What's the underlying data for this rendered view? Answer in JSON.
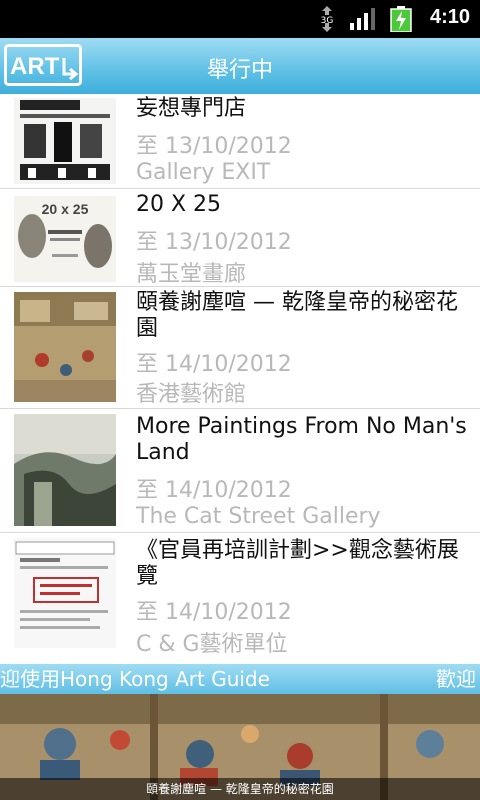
{
  "statusbar": {
    "time": "4:10",
    "network": "3G"
  },
  "header": {
    "logo_text": "ART",
    "title": "舉行中"
  },
  "exhibitions": [
    {
      "title": "妄想專門店",
      "date": "至 13/10/2012",
      "venue": "Gallery EXIT"
    },
    {
      "title": "20 X 25",
      "date": "至 13/10/2012",
      "venue": "萬玉堂畫廊"
    },
    {
      "title": "頤養謝塵喧 — 乾隆皇帝的秘密花園",
      "date": "至 14/10/2012",
      "venue": "香港藝術館"
    },
    {
      "title": "More Paintings From No Man's Land",
      "date": "至 14/10/2012",
      "venue": "The Cat Street Gallery"
    },
    {
      "title": "《官員再培訓計劃>>觀念藝術展覽",
      "date": "至 14/10/2012",
      "venue": "C & G藝術單位"
    }
  ],
  "marquee": {
    "left_text": "迎使用Hong Kong Art Guide",
    "right_text": "歡迎"
  },
  "banner": {
    "caption": "頤養謝塵喧 — 乾隆皇帝的秘密花園"
  },
  "colors": {
    "header_blue": "#5fc0e6",
    "secondary_text": "#b8b8b8"
  }
}
